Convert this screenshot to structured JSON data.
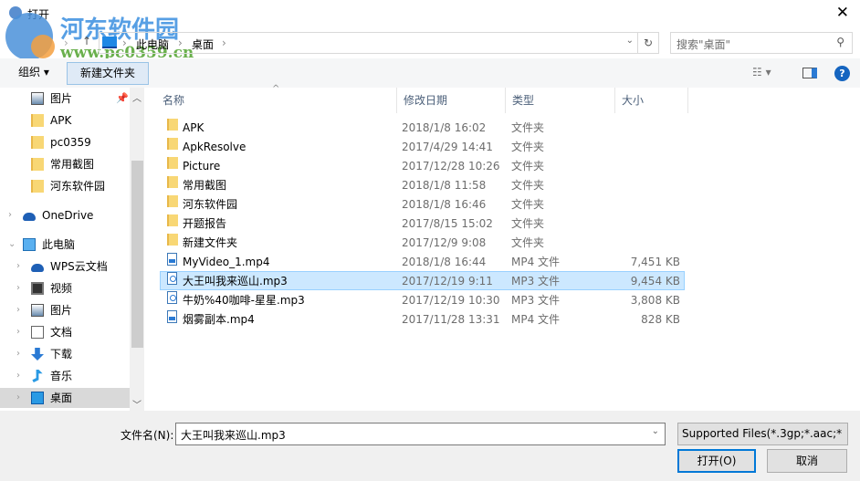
{
  "window": {
    "title": "打开",
    "close": "✕"
  },
  "watermark": {
    "site": "河东软件园",
    "url": "www.pc0359.cn"
  },
  "address": {
    "segments": [
      "此电脑",
      "桌面"
    ],
    "search_placeholder": "搜索\"桌面\""
  },
  "toolbar": {
    "organize": "组织 ▾",
    "new_folder": "新建文件夹"
  },
  "sidebar": {
    "items": [
      {
        "label": "图片",
        "icon": "pictures-icon"
      },
      {
        "label": "APK",
        "icon": "folder-icon"
      },
      {
        "label": "pc0359",
        "icon": "folder-icon"
      },
      {
        "label": "常用截图",
        "icon": "folder-icon"
      },
      {
        "label": "河东软件园",
        "icon": "folder-icon"
      },
      {
        "label": "OneDrive",
        "icon": "cloud-icon"
      },
      {
        "label": "此电脑",
        "icon": "computer-icon"
      },
      {
        "label": "WPS云文档",
        "icon": "cloud-icon"
      },
      {
        "label": "视频",
        "icon": "video-icon"
      },
      {
        "label": "图片",
        "icon": "pictures-icon"
      },
      {
        "label": "文档",
        "icon": "document-icon"
      },
      {
        "label": "下载",
        "icon": "download-icon"
      },
      {
        "label": "音乐",
        "icon": "music-icon"
      },
      {
        "label": "桌面",
        "icon": "desktop-icon"
      }
    ]
  },
  "columns": {
    "name": "名称",
    "date": "修改日期",
    "type": "类型",
    "size": "大小"
  },
  "files": [
    {
      "name": "APK",
      "date": "2018/1/8 16:02",
      "type": "文件夹",
      "size": "",
      "kind": "folder"
    },
    {
      "name": "ApkResolve",
      "date": "2017/4/29 14:41",
      "type": "文件夹",
      "size": "",
      "kind": "folder"
    },
    {
      "name": "Picture",
      "date": "2017/12/28 10:26",
      "type": "文件夹",
      "size": "",
      "kind": "folder"
    },
    {
      "name": "常用截图",
      "date": "2018/1/8 11:58",
      "type": "文件夹",
      "size": "",
      "kind": "folder"
    },
    {
      "name": "河东软件园",
      "date": "2018/1/8 16:46",
      "type": "文件夹",
      "size": "",
      "kind": "folder"
    },
    {
      "name": "开题报告",
      "date": "2017/8/15 15:02",
      "type": "文件夹",
      "size": "",
      "kind": "folder"
    },
    {
      "name": "新建文件夹",
      "date": "2017/12/9 9:08",
      "type": "文件夹",
      "size": "",
      "kind": "folder"
    },
    {
      "name": "MyVideo_1.mp4",
      "date": "2018/1/8 16:44",
      "type": "MP4 文件",
      "size": "7,451 KB",
      "kind": "mp4"
    },
    {
      "name": "大王叫我来巡山.mp3",
      "date": "2017/12/19 9:11",
      "type": "MP3 文件",
      "size": "9,454 KB",
      "kind": "mp3",
      "selected": true
    },
    {
      "name": "牛奶%40咖啡-星星.mp3",
      "date": "2017/12/19 10:30",
      "type": "MP3 文件",
      "size": "3,808 KB",
      "kind": "mp3"
    },
    {
      "name": "烟雾副本.mp4",
      "date": "2017/11/28 13:31",
      "type": "MP4 文件",
      "size": "828 KB",
      "kind": "mp4"
    }
  ],
  "footer": {
    "filename_label": "文件名(N):",
    "filename_value": "大王叫我来巡山.mp3",
    "filter": "Supported Files(*.3gp;*.aac;*",
    "open": "打开(O)",
    "cancel": "取消"
  },
  "colors": {
    "accent": "#0078d7",
    "selection": "#cce8ff"
  }
}
